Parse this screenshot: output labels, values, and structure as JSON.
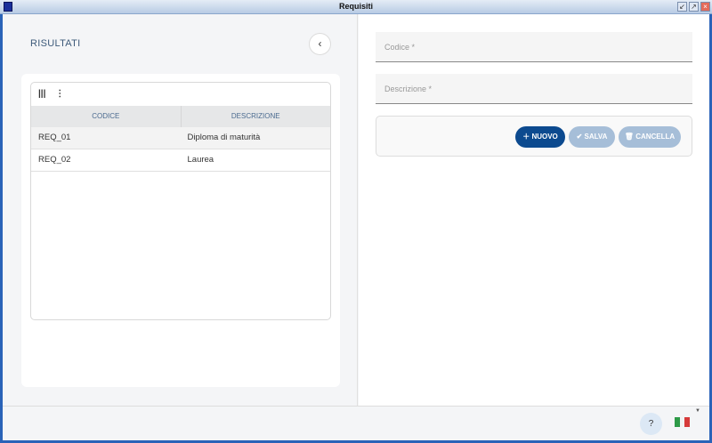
{
  "window": {
    "title": "Requisiti",
    "buttons": [
      "minimize",
      "maximize",
      "close"
    ]
  },
  "results": {
    "title": "RISULTATI",
    "back_icon": "chevron-left-icon",
    "toolbar": {
      "columns_icon": "columns-icon",
      "menu_icon": "more-vertical-icon"
    },
    "columns": [
      "CODICE",
      "DESCRIZIONE"
    ],
    "rows": [
      {
        "codice": "REQ_01",
        "descrizione": "Diploma di maturità"
      },
      {
        "codice": "REQ_02",
        "descrizione": "Laurea"
      }
    ]
  },
  "form": {
    "codice_placeholder": "Codice *",
    "descrizione_placeholder": "Descrizione *",
    "buttons": {
      "new": "NUOVO",
      "save": "SALVA",
      "cancel": "CANCELLA"
    }
  },
  "footer": {
    "help": "?",
    "language": "it"
  },
  "colors": {
    "primary": "#0c4a8f",
    "disabled": "#a6bed8"
  }
}
